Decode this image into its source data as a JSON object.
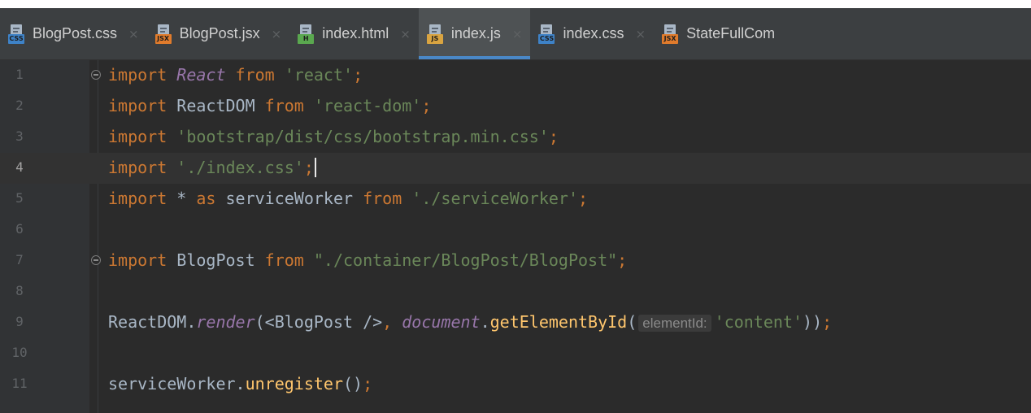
{
  "colors": {
    "background": "#2b2b2b",
    "tab_bar": "#3c3f41",
    "active_tab_underline": "#4a88c7",
    "keyword": "#cc7832",
    "string": "#6a8759",
    "plain": "#a9b7c6",
    "method": "#ffc66d",
    "static_member": "#9876aa"
  },
  "tabs": [
    {
      "label": "BlogPost.css",
      "badge": "CSS",
      "badge_color": "#3e82c7",
      "icon": "css-file-icon",
      "active": false
    },
    {
      "label": "BlogPost.jsx",
      "badge": "JSX",
      "badge_color": "#e07b2c",
      "icon": "jsx-file-icon",
      "active": false
    },
    {
      "label": "index.html",
      "badge": "H",
      "badge_color": "#5aa84f",
      "icon": "html-file-icon",
      "active": false
    },
    {
      "label": "index.js",
      "badge": "JS",
      "badge_color": "#d9a441",
      "icon": "js-file-icon",
      "active": true
    },
    {
      "label": "index.css",
      "badge": "CSS",
      "badge_color": "#3e82c7",
      "icon": "css-file-icon",
      "active": false
    },
    {
      "label": "StateFullCom",
      "badge": "JSX",
      "badge_color": "#e07b2c",
      "icon": "jsx-file-icon",
      "active": false
    }
  ],
  "tab_close_glyph": "×",
  "current_line": 4,
  "lines": [
    {
      "n": "1",
      "fold": true,
      "tokens": [
        {
          "t": "import ",
          "c": "kw"
        },
        {
          "t": "React",
          "c": "cls"
        },
        {
          "t": " from ",
          "c": "kw"
        },
        {
          "t": "'react'",
          "c": "str"
        },
        {
          "t": ";",
          "c": "kw"
        }
      ]
    },
    {
      "n": "2",
      "fold": false,
      "tokens": [
        {
          "t": "import ",
          "c": "kw"
        },
        {
          "t": "ReactDOM",
          "c": "pm"
        },
        {
          "t": " from ",
          "c": "kw"
        },
        {
          "t": "'react-dom'",
          "c": "str"
        },
        {
          "t": ";",
          "c": "kw"
        }
      ]
    },
    {
      "n": "3",
      "fold": false,
      "tokens": [
        {
          "t": "import ",
          "c": "kw"
        },
        {
          "t": "'bootstrap/dist/css/bootstrap.min.css'",
          "c": "str"
        },
        {
          "t": ";",
          "c": "kw"
        }
      ]
    },
    {
      "n": "4",
      "fold": false,
      "caret": true,
      "tokens": [
        {
          "t": "import ",
          "c": "kw"
        },
        {
          "t": "'./index.css'",
          "c": "str"
        },
        {
          "t": ";",
          "c": "kw"
        }
      ]
    },
    {
      "n": "5",
      "fold": false,
      "tokens": [
        {
          "t": "import ",
          "c": "kw"
        },
        {
          "t": "* ",
          "c": "pm"
        },
        {
          "t": "as ",
          "c": "kw"
        },
        {
          "t": "serviceWorker",
          "c": "pm"
        },
        {
          "t": " from ",
          "c": "kw"
        },
        {
          "t": "'./serviceWorker'",
          "c": "str"
        },
        {
          "t": ";",
          "c": "kw"
        }
      ]
    },
    {
      "n": "6",
      "fold": false,
      "tokens": []
    },
    {
      "n": "7",
      "fold": true,
      "tokens": [
        {
          "t": "import ",
          "c": "kw"
        },
        {
          "t": "BlogPost",
          "c": "pm"
        },
        {
          "t": " from ",
          "c": "kw"
        },
        {
          "t": "\"./container/BlogPost/BlogPost\"",
          "c": "str"
        },
        {
          "t": ";",
          "c": "kw"
        }
      ]
    },
    {
      "n": "8",
      "fold": false,
      "tokens": []
    },
    {
      "n": "9",
      "fold": false,
      "tokens": [
        {
          "t": "ReactDOM.",
          "c": "pm"
        },
        {
          "t": "render",
          "c": "fnit"
        },
        {
          "t": "(<BlogPost />",
          "c": "pm"
        },
        {
          "t": ", ",
          "c": "kw"
        },
        {
          "t": "document",
          "c": "fnit"
        },
        {
          "t": ".",
          "c": "pm"
        },
        {
          "t": "getElementById",
          "c": "fn"
        },
        {
          "t": "(",
          "c": "pm"
        },
        {
          "t": "elementId:",
          "c": "hint"
        },
        {
          "t": "'content'",
          "c": "str"
        },
        {
          "t": "))",
          "c": "pm"
        },
        {
          "t": ";",
          "c": "kw"
        }
      ]
    },
    {
      "n": "10",
      "fold": false,
      "tokens": []
    },
    {
      "n": "11",
      "fold": false,
      "tokens": [
        {
          "t": "serviceWorker.",
          "c": "pm"
        },
        {
          "t": "unregister",
          "c": "fn"
        },
        {
          "t": "()",
          "c": "pm"
        },
        {
          "t": ";",
          "c": "kw"
        }
      ]
    }
  ]
}
